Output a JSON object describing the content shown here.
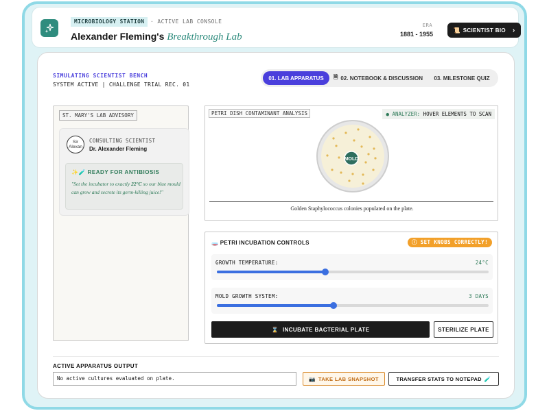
{
  "header": {
    "station_badge": "MICROBIOLOGY STATION",
    "console_label": "· ACTIVE LAB CONSOLE",
    "title_main": "Alexander Fleming's",
    "title_accent": "Breakthrough Lab",
    "era_label": "ERA",
    "era_value": "1881 - 1955",
    "bio_button": "SCIENTIST BIO",
    "bio_icon_glyph": "📜",
    "bio_chevron": "›"
  },
  "bench": {
    "title": "SIMULATING SCIENTIST BENCH",
    "subtitle": "SYSTEM ACTIVE | CHALLENGE TRIAL REC. 01"
  },
  "tabs": [
    {
      "label": "01. LAB APPARATUS",
      "active": true
    },
    {
      "label": "02. NOTEBOOK & DISCUSSION",
      "active": false,
      "icon_glyph": "🗎"
    },
    {
      "label": "03. MILESTONE QUIZ",
      "active": false
    }
  ],
  "advisory": {
    "label": "ST. MARY'S LAB ADVISORY",
    "avatar_alt_line1": "Sir",
    "avatar_alt_line2": "Alexan",
    "role": "CONSULTING SCIENTIST",
    "name": "Dr. Alexander Fleming",
    "ready_icon_glyph": "✨🧪",
    "ready_title": "READY FOR ANTIBIOSIS",
    "quote_part1": "\"Set the incubator to exactly ",
    "quote_bold": "22°C",
    "quote_part2": " so our blue mould can grow and secrete its germ-killing juice!\""
  },
  "petri": {
    "label": "PETRI DISH CONTAMINANT ANALYSIS",
    "analyzer_dot": "●",
    "analyzer_key": "ANALYZER:",
    "analyzer_value": "HOVER ELEMENTS TO SCAN",
    "mold_label": "MOLD",
    "caption": "Golden Staphylococcus colonies populated on the plate."
  },
  "controls": {
    "icon_glyph": "🧫",
    "title": "PETRI INCUBATION CONTROLS",
    "warn_icon_glyph": "ⓘ",
    "warn_badge": "SET KNOBS CORRECTLY!",
    "sliders": [
      {
        "label": "GROWTH TEMPERATURE:",
        "value": "24°C",
        "fraction": 0.4
      },
      {
        "label": "MOLD GROWTH SYSTEM:",
        "value": "3 DAYS",
        "fraction": 0.43
      }
    ],
    "incubate_icon_glyph": "⌛",
    "incubate_button": "INCUBATE BACTERIAL PLATE",
    "sterilize_button": "STERILIZE PLATE"
  },
  "output": {
    "title": "ACTIVE APPARATUS OUTPUT",
    "field_value": "No active cultures evaluated on plate.",
    "snapshot_icon_glyph": "📷",
    "snapshot_button": "TAKE LAB SNAPSHOT",
    "transfer_button": "TRANSFER STATS TO NOTEPAD",
    "transfer_icon_glyph": "🧪"
  },
  "colors": {
    "accent_indigo": "#4a3fdc",
    "accent_teal": "#2f8c7e",
    "accent_green": "#2e7a58",
    "warning_orange": "#f2a02a",
    "slider_blue": "#3b6fe0"
  }
}
